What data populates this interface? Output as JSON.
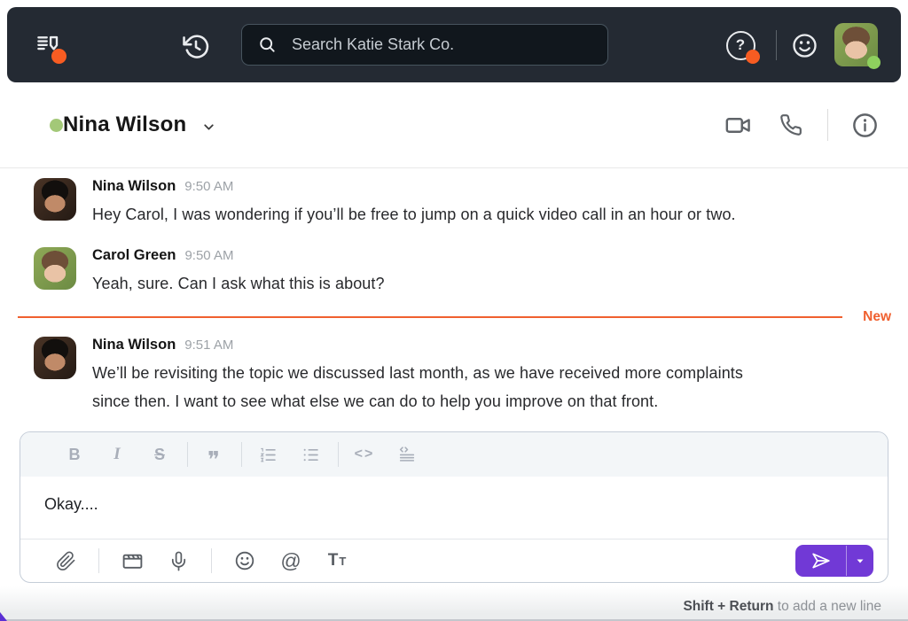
{
  "top_bar": {
    "search_placeholder": "Search Katie Stark Co."
  },
  "channel_header": {
    "name": "Nina Wilson",
    "status": "online"
  },
  "messages": [
    {
      "name": "Nina Wilson",
      "time": "9:50 AM",
      "text": "Hey Carol, I was wondering if you’ll be free to jump on a quick video call in an hour or two."
    },
    {
      "name": "Carol Green",
      "time": "9:50 AM",
      "text": "Yeah, sure. Can I ask what this is about?"
    },
    {
      "name": "Nina Wilson",
      "time": "9:51 AM",
      "text": "We’ll be revisiting the topic we discussed last month, as we have received more complaints\nsince then. I want to see what else we can do to help you improve on that front."
    }
  ],
  "new_divider": {
    "label": "New"
  },
  "composer": {
    "value": "Okay....",
    "toolbar": {
      "bold": "B",
      "italic": "I",
      "strike": "S",
      "quote": "❞",
      "inline_code": "<>"
    },
    "at_sign": "@",
    "tt_big": "T",
    "tt_small": "T"
  },
  "footer": {
    "hint_bold": "Shift + Return",
    "hint_rest": " to add a new line"
  },
  "icons": {
    "help": "?"
  },
  "colors": {
    "header_bg": "#242a33",
    "accent_orange": "#f75c22",
    "new_marker": "#f0602f",
    "presence_green": "#a3c878",
    "online_green": "#8ed05e",
    "send_purple": "#7139d6"
  }
}
